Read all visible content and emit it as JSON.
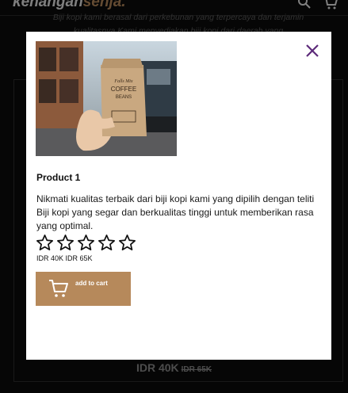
{
  "background": {
    "logo_main": "kenangan",
    "logo_accent": "senja.",
    "tagline": "Biji kopi kami berasal dari perkebunan yang terpercaya dan terjamin kualitasnya Kami menyediakan biji kopi dari daerah yang",
    "card_price": "IDR 40K",
    "card_price_old": "IDR 65K",
    "icons": [
      "search-icon",
      "cart-icon"
    ]
  },
  "modal": {
    "image_bag_text": {
      "line1": "Falls Mix",
      "line2": "COFFEE",
      "line3": "BEANS"
    },
    "title": "Product 1",
    "description": "Nikmati kualitas terbaik dari biji kopi kami yang dipilih dengan teliti Biji kopi yang segar dan berkualitas tinggi untuk memberikan rasa yang optimal.",
    "rating": 0,
    "rating_max": 5,
    "price_line": "IDR 40K IDR 65K",
    "add_to_cart_label": "add to cart",
    "colors": {
      "accent": "#b6895b",
      "close": "#5c2a7a"
    }
  }
}
